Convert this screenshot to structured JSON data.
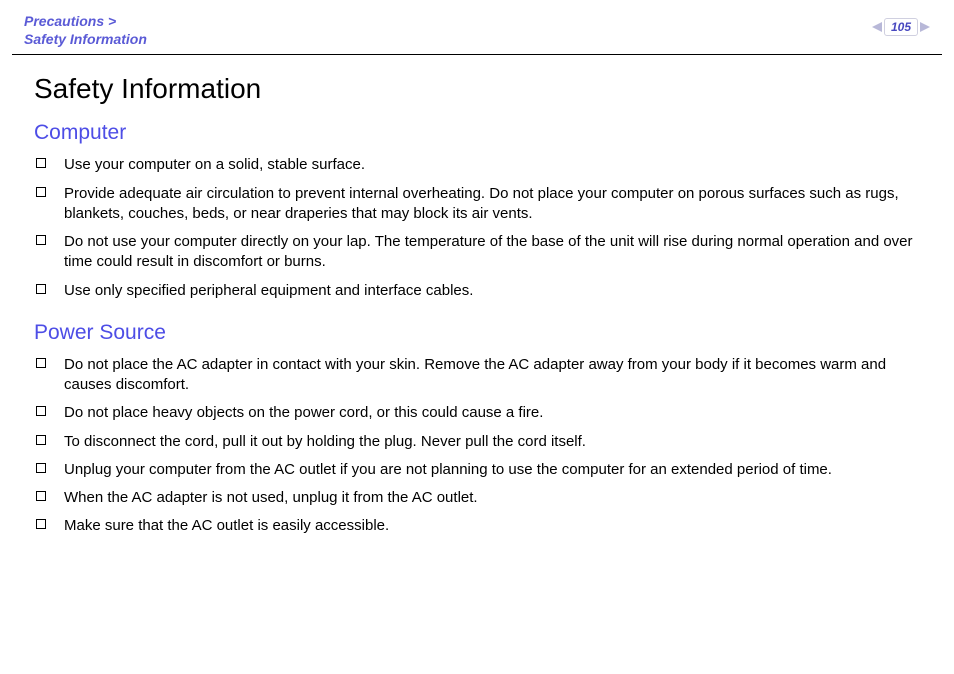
{
  "breadcrumb": {
    "line1": "Precautions >",
    "line2": "Safety Information"
  },
  "page_number": "105",
  "title": "Safety Information",
  "sections": [
    {
      "heading": "Computer",
      "items": [
        "Use your computer on a solid, stable surface.",
        "Provide adequate air circulation to prevent internal overheating. Do not place your computer on porous surfaces such as rugs, blankets, couches, beds, or near draperies that may block its air vents.",
        "Do not use your computer directly on your lap. The temperature of the base of the unit will rise during normal operation and over time could result in discomfort or burns.",
        "Use only specified peripheral equipment and interface cables."
      ]
    },
    {
      "heading": "Power Source",
      "items": [
        "Do not place the AC adapter in contact with your skin. Remove the AC adapter away from your body if it becomes warm and causes discomfort.",
        "Do not place heavy objects on the power cord, or this could cause a fire.",
        "To disconnect the cord, pull it out by holding the plug. Never pull the cord itself.",
        "Unplug your computer from the AC outlet if you are not planning to use the computer for an extended period of time.",
        "When the AC adapter is not used, unplug it from the AC outlet.",
        "Make sure that the AC outlet is easily accessible."
      ]
    }
  ]
}
